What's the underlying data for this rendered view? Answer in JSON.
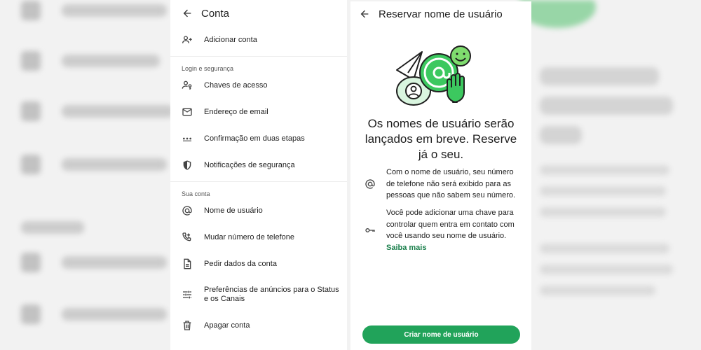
{
  "left_panel": {
    "title": "Conta",
    "add_account": "Adicionar conta",
    "section_login": "Login e segurança",
    "login_items": [
      {
        "label": "Chaves de acesso",
        "icon": "passkey-icon"
      },
      {
        "label": "Endereço de email",
        "icon": "email-icon"
      },
      {
        "label": "Confirmação em duas etapas",
        "icon": "two-step-icon"
      },
      {
        "label": "Notificações de segurança",
        "icon": "shield-icon"
      }
    ],
    "section_account": "Sua conta",
    "account_items": [
      {
        "label": "Nome de usuário",
        "icon": "at-icon"
      },
      {
        "label": "Mudar número de telefone",
        "icon": "phone-change-icon"
      },
      {
        "label": "Pedir dados da conta",
        "icon": "document-icon"
      },
      {
        "label": "Preferências de anúncios para o Status e os Canais",
        "icon": "tune-icon"
      },
      {
        "label": "Apagar conta",
        "icon": "trash-icon"
      }
    ]
  },
  "right_panel": {
    "title": "Reservar nome de usuário",
    "headline": "Os nomes de usuário serão lançados em breve. Reserve já o seu.",
    "info1": "Com o nome de usuário, seu número de telefone não será exibido para as pessoas que não sabem seu número.",
    "info2": "Você pode adicionar uma chave para controlar quem entra em contato com você usando seu nome de usuário.",
    "learn_more": "Saiba mais",
    "cta": "Criar nome de usuário"
  },
  "colors": {
    "accent": "#21a35a",
    "link": "#1a7f4b",
    "illustration_green": "#3cc85f"
  }
}
